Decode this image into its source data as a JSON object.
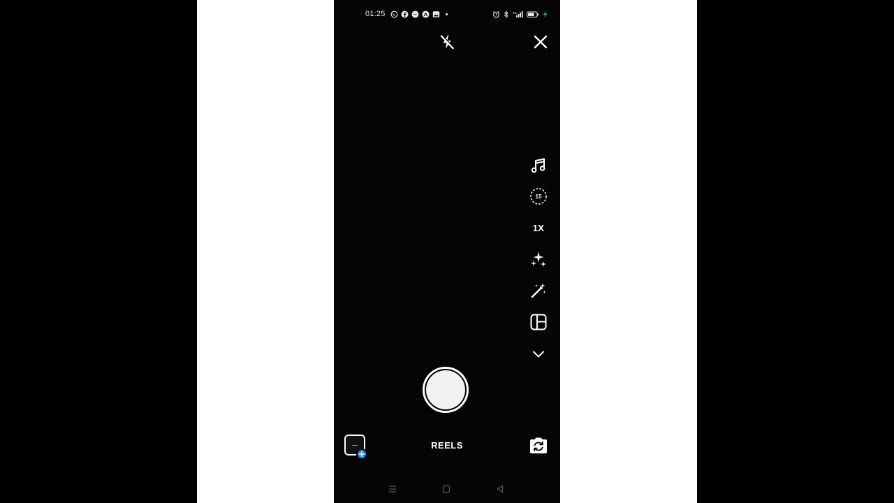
{
  "status_bar": {
    "time": "01:25",
    "left_icons": [
      "whatsapp-icon",
      "facebook-icon",
      "messenger-icon",
      "app-icon",
      "gallery-notification-icon",
      "more-dot-icon"
    ],
    "right_icons": [
      "alarm-icon",
      "bluetooth-icon",
      "signal-icon",
      "battery-icon",
      "charging-icon"
    ]
  },
  "top_controls": {
    "flash_icon": "flash-off-icon",
    "close_icon": "close-icon"
  },
  "tools": [
    {
      "name": "music",
      "icon": "music-note-icon"
    },
    {
      "name": "timer",
      "icon": "timer-icon",
      "value": "15"
    },
    {
      "name": "speed",
      "icon": "speed-icon",
      "label": "1X"
    },
    {
      "name": "effects",
      "icon": "sparkles-icon"
    },
    {
      "name": "touch-up",
      "icon": "magic-wand-icon"
    },
    {
      "name": "layout",
      "icon": "layout-icon"
    },
    {
      "name": "more",
      "icon": "chevron-down-icon"
    }
  ],
  "capture": {
    "mode_label": "REELS"
  },
  "colors": {
    "background": "#050505",
    "accent_blue": "#1e88f5",
    "icon": "#ffffff"
  },
  "nav_bar": {
    "icons": [
      "menu-icon",
      "home-square-icon",
      "back-triangle-icon"
    ]
  }
}
